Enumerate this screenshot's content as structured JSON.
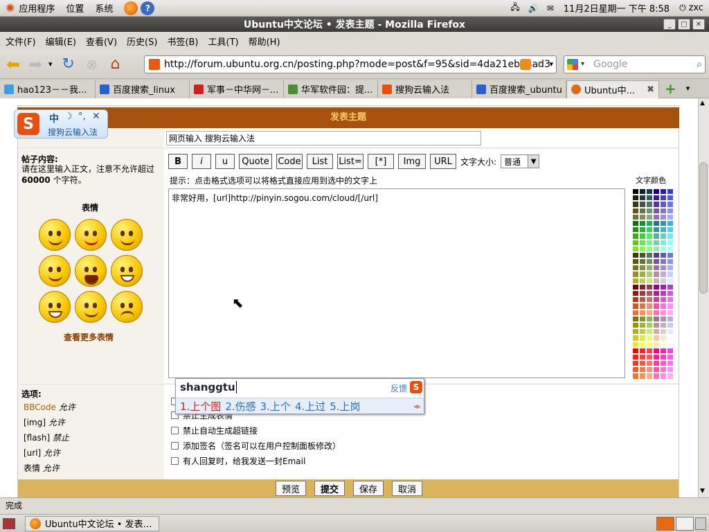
{
  "panel": {
    "menus": [
      "应用程序",
      "位置",
      "系统"
    ],
    "clock": "11月2日星期一 下午 8:58",
    "user": "zxc"
  },
  "window": {
    "title": "Ubuntu中文论坛 • 发表主题 - Mozilla Firefox"
  },
  "menubar": [
    "文件(F)",
    "编辑(E)",
    "查看(V)",
    "历史(S)",
    "书签(B)",
    "工具(T)",
    "帮助(H)"
  ],
  "navbar": {
    "url": "http://forum.ubuntu.org.cn/posting.php?mode=post&f=95&sid=4da21eba4ad3",
    "search_placeholder": "Google"
  },
  "tabs": [
    {
      "label": "hao123－－我...",
      "color": "#3aa0e0"
    },
    {
      "label": "百度搜索_linux",
      "color": "#2a5fd0"
    },
    {
      "label": "军事－中华网－...",
      "color": "#d02020"
    },
    {
      "label": "华军软件园：提...",
      "color": "#4a9030"
    },
    {
      "label": "搜狗云输入法",
      "color": "#e85010"
    },
    {
      "label": "百度搜索_ubuntu",
      "color": "#2a5fd0"
    },
    {
      "label": "Ubuntu中...",
      "color": "#e06a1a"
    }
  ],
  "form": {
    "header": "发表主题",
    "subject_value": "网页输入 搜狗云输入法",
    "content_label": "帖子内容:",
    "content_hint1": "请在这里输入正文，注意不允许超过",
    "content_hint_num": "60000",
    "content_hint2": "个字符。",
    "smiley_title": "表情",
    "more_smileys": "查看更多表情",
    "buttons": [
      "B",
      "i",
      "u",
      "Quote",
      "Code",
      "List",
      "List=",
      "[*]",
      "Img",
      "URL"
    ],
    "fontsize_label": "文字大小:",
    "fontsize_value": "普通",
    "tip": "提示：点击格式选项可以将格式直接应用到选中的文字上",
    "color_label": "文字颜色",
    "body_text": "非常好用，[url]http://pinyin.sogou.com/cloud/[/url]",
    "options_label": "选项:",
    "status": [
      {
        "name": "BBCode",
        "state": "允许"
      },
      {
        "name": "[img]",
        "state": "允许"
      },
      {
        "name": "[flash]",
        "state": "禁止"
      },
      {
        "name": "[url]",
        "state": "允许"
      },
      {
        "name": "表情",
        "state": "允许"
      }
    ],
    "checkboxes": [
      "禁止生成表情",
      "禁止自动生成超链接",
      "添加签名（签名可以在用户控制面板修改）",
      "有人回复时，给我发送一封Email"
    ],
    "submit_buttons": [
      "预览",
      "提交",
      "保存",
      "取消"
    ]
  },
  "ime": {
    "toolbar_text": "中",
    "toolbar_name": "搜狗云输入法",
    "pinyin": "shanggtu",
    "feedback": "反馈",
    "candidates": [
      "1.上个图",
      "2.伤感",
      "3.上个",
      "4.上过",
      "5.上岗"
    ]
  },
  "status_bar": "完成",
  "taskbar": {
    "item": "Ubuntu中文论坛 • 发表…"
  }
}
